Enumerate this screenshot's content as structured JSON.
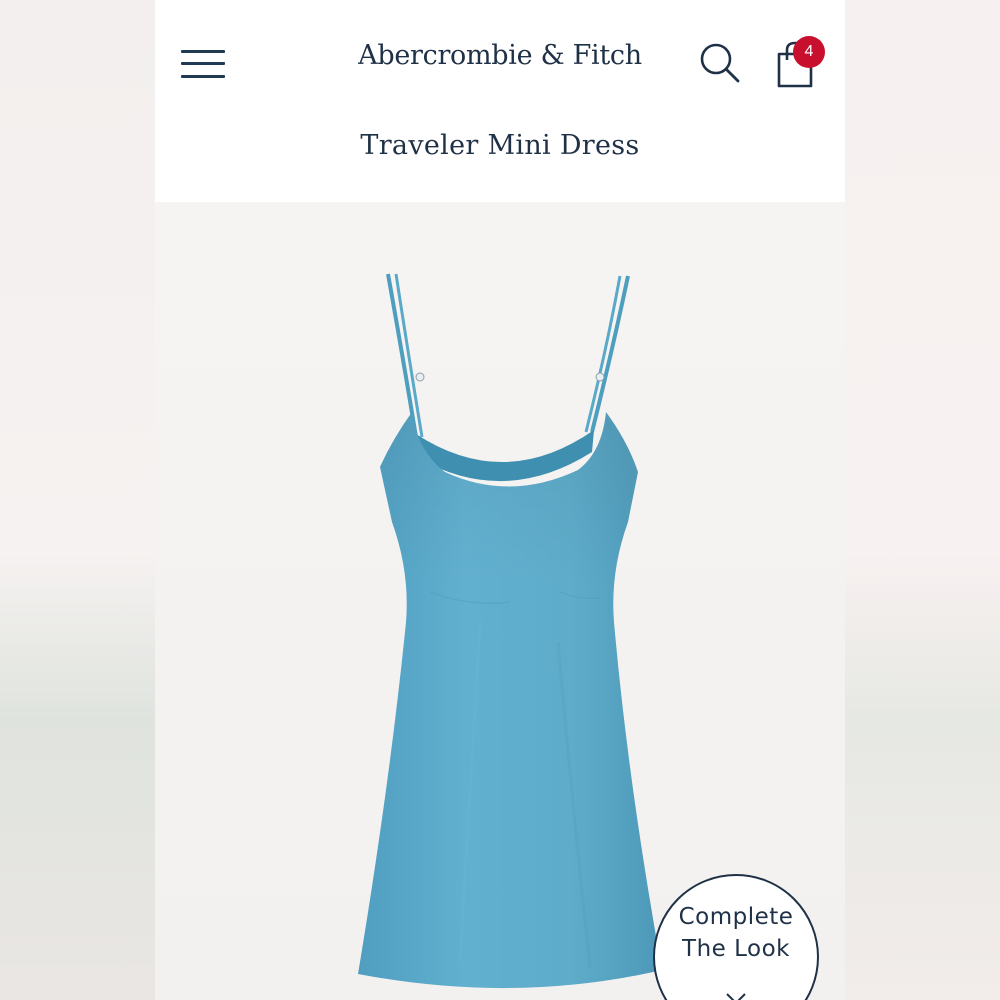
{
  "header": {
    "brand": "Abercrombie & Fitch",
    "cart_count": "4",
    "product_title": "Traveler Mini Dress"
  },
  "icons": {
    "menu": "hamburger-menu-icon",
    "search": "search-icon",
    "bag": "shopping-bag-icon",
    "chevron": "chevron-down-icon"
  },
  "product_image": {
    "subject": "dress",
    "color": "#5ba9c9"
  },
  "complete_look": {
    "line1": "Complete",
    "line2": "The Look"
  },
  "colors": {
    "brand_navy": "#1f3146",
    "badge_red": "#c8102e",
    "background": "#f5f3f1"
  }
}
